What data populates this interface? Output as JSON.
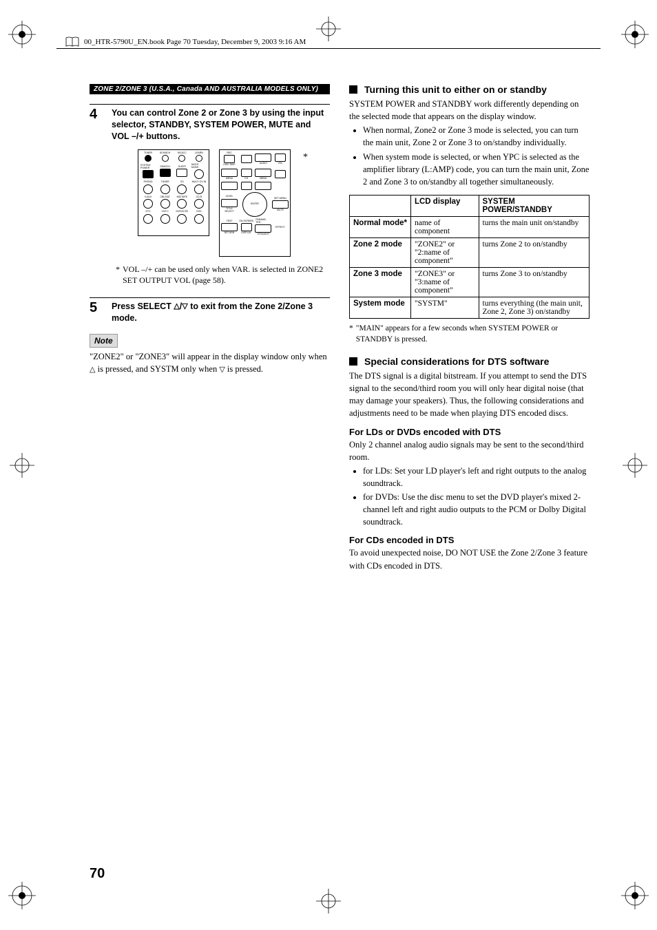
{
  "header_line": "00_HTR-5790U_EN.book  Page 70  Tuesday, December 9, 2003  9:16 AM",
  "section_bar": "ZONE 2/ZONE 3 (U.S.A., Canada AND AUSTRALIA MODELS ONLY)",
  "step4": {
    "num": "4",
    "text": "You can control Zone 2 or Zone 3 by using the input selector, STANDBY, SYSTEM POWER, MUTE and VOL –/+ buttons."
  },
  "remote_left": {
    "top": [
      "TUNER",
      "6CH/8CH",
      "MCACC",
      "LEARN"
    ],
    "r1": [
      "SYSTEM POWER",
      "SEARCH",
      "SLEEP",
      "NIGHT MODE"
    ],
    "r2": [
      "PHONO",
      "TUNER",
      "CD",
      "MULTI CH IN"
    ],
    "r3": [
      "V-AUX",
      "CBL/SAT",
      "MD/TAPE",
      "CD-R"
    ],
    "r4": [
      "DTV",
      "VCR 1",
      "DVR/VCR2",
      "DVD"
    ]
  },
  "remote_right": {
    "rec_label": "REC",
    "disc_skip": "DISC SKIP",
    "audio": "AUDIO",
    "vol": "VOL",
    "menu_l": "MENU",
    "ch": "CH",
    "menu_r": "MENU",
    "level": "LEVEL",
    "title": "TITLE",
    "select": "SELECT",
    "set_menu": "SET MENU",
    "enter": "ENTER",
    "mute": "MUTE",
    "test": "TEST",
    "return": "RETURN",
    "on_screen": "ON SCREEN",
    "display": "DISPLAY",
    "parame": "PARAME-TER",
    "straight": "STRAIGHT",
    "effect": "EFFECT"
  },
  "asterisk": "*",
  "step4_footnote": "VOL –/+ can be used only when VAR. is selected in ZONE2 SET OUTPUT VOL (page 58).",
  "step5": {
    "num": "5",
    "prefix": "Press SELECT ",
    "suffix": " to exit from the Zone 2/Zone 3 mode."
  },
  "note_label": "Note",
  "note_body_a": "\"ZONE2\" or \"ZONE3\" will appear in the display window only when ",
  "note_body_b": " is pressed, and SYSTM only when ",
  "note_body_c": " is pressed.",
  "right": {
    "sub1": "Turning this unit to either on or standby",
    "p1": "SYSTEM POWER and STANDBY work differently depending on the selected mode that appears on the display window.",
    "b1": "When normal, Zone2 or Zone 3 mode is selected, you can turn the main unit, Zone 2 or Zone 3 to on/standby individually.",
    "b2": "When system mode is selected, or when YPC is selected as the amplifier library (L:AMP) code, you can turn the main unit, Zone 2 and Zone 3 to on/standby all together simultaneously.",
    "table": {
      "h1": "",
      "h2": "LCD display",
      "h3": "SYSTEM POWER/STANDBY",
      "rows": [
        {
          "m": "Normal mode*",
          "lcd": "name of component",
          "sp": "turns the main unit on/standby"
        },
        {
          "m": "Zone 2 mode",
          "lcd": "\"ZONE2\" or \"2:name of component\"",
          "sp": "turns Zone 2 to on/standby"
        },
        {
          "m": "Zone 3 mode",
          "lcd": "\"ZONE3\" or \"3:name of component\"",
          "sp": "turns Zone 3 to on/standby"
        },
        {
          "m": "System mode",
          "lcd": "\"SYSTM\"",
          "sp": "turns everything (the main unit, Zone 2, Zone 3) on/standby"
        }
      ]
    },
    "table_note_mark": "*",
    "table_note": "\"MAIN\" appears for a few seconds when SYSTEM POWER or STANDBY is pressed.",
    "sub2": "Special considerations for DTS software",
    "p2": "The DTS signal is a digital bitstream. If you attempt to send the DTS signal to the second/third room you will only hear digital noise (that may damage your speakers). Thus, the following considerations and adjustments need to be made when playing DTS encoded discs.",
    "sub2a": "For LDs or DVDs encoded with DTS",
    "p2a": "Only 2 channel analog audio signals may be sent to the second/third room.",
    "b2a1": "for LDs: Set your LD player's left and right outputs to the analog soundtrack.",
    "b2a2": "for DVDs: Use the disc menu to set the DVD player's mixed 2-channel left and right audio outputs to the PCM or Dolby Digital soundtrack.",
    "sub2b": "For CDs encoded in DTS",
    "p2b": "To avoid unexpected noise, DO NOT USE the Zone 2/Zone 3 feature with CDs encoded in DTS."
  },
  "page_number": "70"
}
